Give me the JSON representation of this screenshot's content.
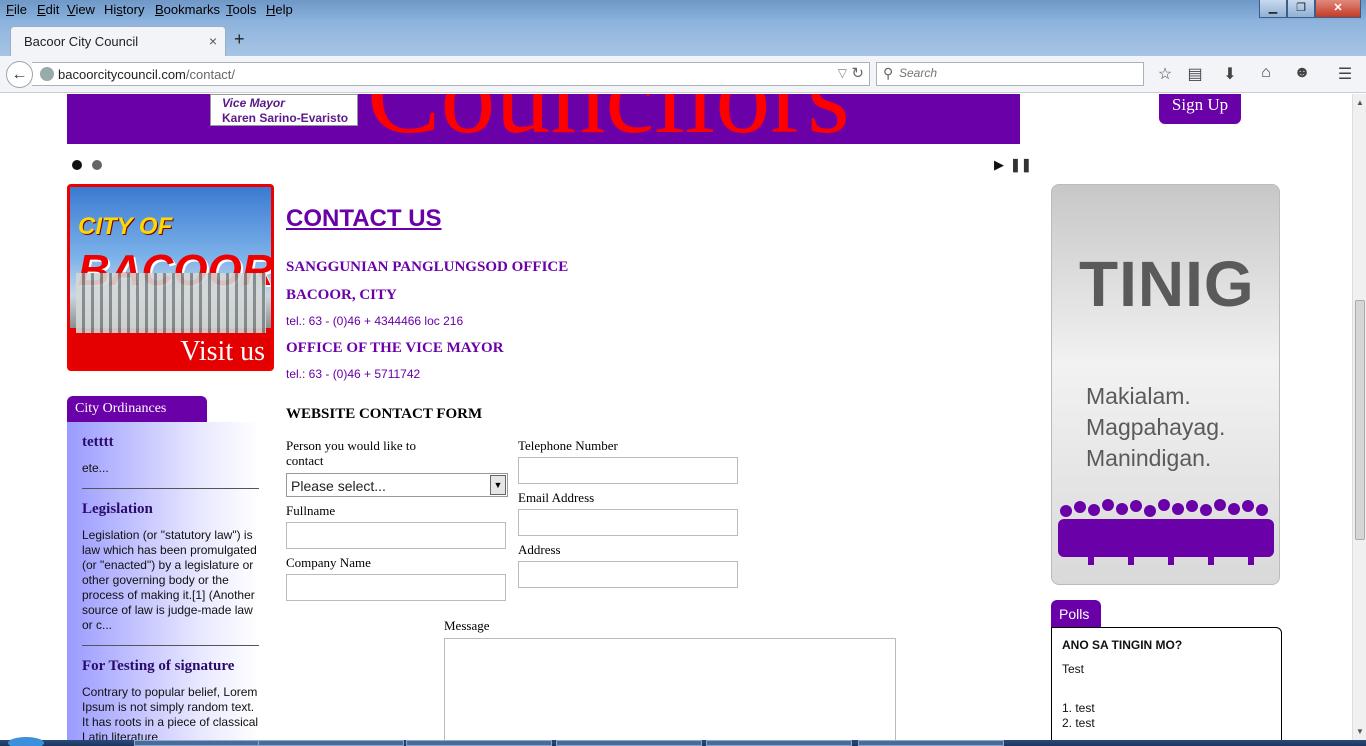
{
  "browser": {
    "menu": [
      "File",
      "Edit",
      "View",
      "History",
      "Bookmarks",
      "Tools",
      "Help"
    ],
    "menu_access": [
      "F",
      "E",
      "V",
      "s",
      "B",
      "T",
      "H"
    ],
    "tab_title": "Bacoor City Council",
    "tab_close": "×",
    "new_tab": "+",
    "url_host": "bacoorcitycouncil.com",
    "url_path": "/contact/",
    "search_placeholder": "Search"
  },
  "banner": {
    "big_text": "Councilors",
    "vice_mayor_title": "Vice Mayor",
    "vice_mayor_name": "Karen Sarino-Evaristo",
    "signup_label": "Sign Up"
  },
  "slider": {
    "play": "▶",
    "pause": "❚❚"
  },
  "visit_image": {
    "city_of": "CITY OF",
    "bacoor": "BACOOR",
    "visit": "Visit us"
  },
  "ordinances": {
    "tab": "City Ordinances",
    "items": [
      {
        "title": "tetttt",
        "text": "ete..."
      },
      {
        "title": "Legislation",
        "text": "Legislation (or \"statutory law\") is law which has been promulgated (or \"enacted\") by a legislature or other governing body or the process of making it.[1] (Another source of law is judge-made law or c..."
      },
      {
        "title": "For Testing of signature",
        "text": "Contrary to popular belief, Lorem Ipsum is not simply random text. It has roots in a piece of classical Latin literature"
      }
    ]
  },
  "contact": {
    "title": "CONTACT US",
    "office1": "SANGGUNIAN PANGLUNGSOD OFFICE",
    "office1_city": "BACOOR, CITY",
    "tel1": "tel.: 63 - (0)46 + 4344466 loc 216",
    "office2": "OFFICE OF THE VICE MAYOR",
    "tel2": "tel.: 63 - (0)46 + 5711742"
  },
  "form": {
    "title": "WEBSITE CONTACT FORM",
    "person_label_1": "Person you would like to",
    "person_label_2": "contact",
    "person_select": "Please select...",
    "fullname_label": "Fullname",
    "company_label": "Company Name",
    "telephone_label": "Telephone Number",
    "email_label": "Email Address",
    "address_label": "Address",
    "message_label": "Message"
  },
  "tinig": {
    "title": "TINIG",
    "lines": [
      "Makialam.",
      "Magpahayag.",
      "Manindigan."
    ]
  },
  "polls": {
    "tab": "Polls",
    "question": "ANO SA TINGIN MO?",
    "text": "Test",
    "options": [
      "1. test",
      "2. test"
    ]
  },
  "colors": {
    "brand_purple": "#6a00a8",
    "banner_red": "#ff0000"
  }
}
